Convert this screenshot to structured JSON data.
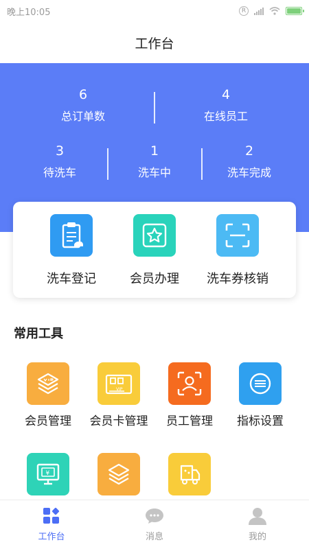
{
  "status_bar": {
    "time": "晚上10:05",
    "r_badge": "R"
  },
  "header": {
    "title": "工作台"
  },
  "stats": [
    {
      "value": "6",
      "label": "总订单数"
    },
    {
      "value": "4",
      "label": "在线员工"
    },
    {
      "value": "3",
      "label": "待洗车"
    },
    {
      "value": "1",
      "label": "洗车中"
    },
    {
      "value": "2",
      "label": "洗车完成"
    }
  ],
  "quick_actions": [
    {
      "label": "洗车登记",
      "icon": "clipboard-car-icon",
      "color": "#2f9bf2"
    },
    {
      "label": "会员办理",
      "icon": "star-card-icon",
      "color": "#29d3bb"
    },
    {
      "label": "洗车券核销",
      "icon": "scan-icon",
      "color": "#4cbaf4"
    }
  ],
  "tools_section": {
    "title": "常用工具",
    "items": [
      {
        "label": "会员管理",
        "icon": "vip-layers-icon",
        "color": "#f8ad3f"
      },
      {
        "label": "会员卡管理",
        "icon": "vip-card-icon",
        "color": "#f9cc3a"
      },
      {
        "label": "员工管理",
        "icon": "face-scan-icon",
        "color": "#f56b1f"
      },
      {
        "label": "指标设置",
        "icon": "target-icon",
        "color": "#2fa0ef"
      },
      {
        "label": "",
        "icon": "monitor-money-icon",
        "color": "#2ed3b7"
      },
      {
        "label": "",
        "icon": "vip-layers-icon",
        "color": "#f8ad3f"
      },
      {
        "label": "",
        "icon": "truck-icon",
        "color": "#f9cc3a"
      }
    ]
  },
  "bottom_nav": [
    {
      "label": "工作台",
      "icon": "dashboard-icon",
      "active": true
    },
    {
      "label": "消息",
      "icon": "message-icon",
      "active": false
    },
    {
      "label": "我的",
      "icon": "user-icon",
      "active": false
    }
  ],
  "colors": {
    "primary": "#5b7df7",
    "nav_active": "#4c6ef5",
    "nav_inactive": "#b9b9b9"
  }
}
